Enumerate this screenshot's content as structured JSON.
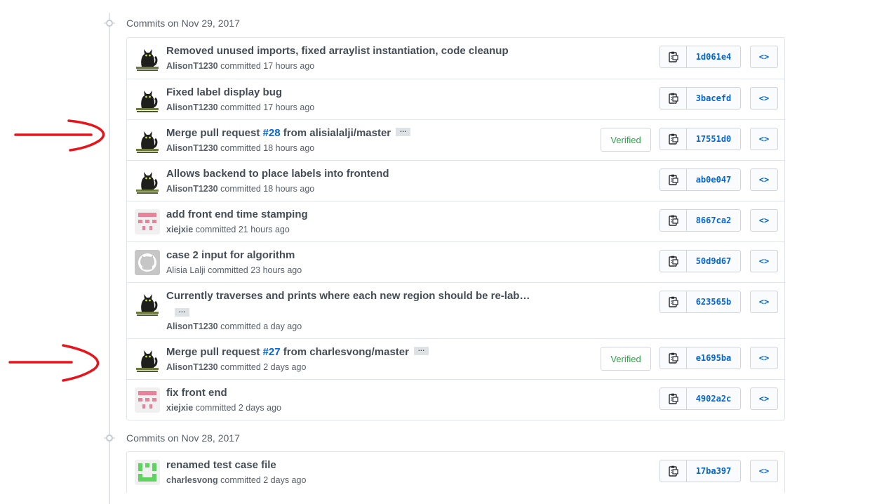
{
  "groups": [
    {
      "title": "Commits on Nov 29, 2017",
      "commits": [
        {
          "message": "Removed unused imports, fixed arraylist instantiation, code cleanup",
          "author": "AlisonT1230",
          "time": "committed 17 hours ago",
          "sha": "1d061e4",
          "avatar": "cat"
        },
        {
          "message": "Fixed label display bug",
          "author": "AlisonT1230",
          "time": "committed 17 hours ago",
          "sha": "3bacefd",
          "avatar": "cat"
        },
        {
          "message_pre": "Merge pull request ",
          "pr": "#28",
          "message_post": " from alisialalji/master",
          "author": "AlisonT1230",
          "time": "committed 18 hours ago",
          "sha": "17551d0",
          "verified": "Verified",
          "avatar": "cat"
        },
        {
          "message": "Allows backend to place labels into frontend",
          "author": "AlisonT1230",
          "time": "committed 18 hours ago",
          "sha": "ab0e047",
          "avatar": "cat"
        },
        {
          "message": "add front end time stamping",
          "author": "xiejxie",
          "time": "committed 21 hours ago",
          "sha": "8667ca2",
          "avatar": "pink-identicon"
        },
        {
          "message": "case 2 input for algorithm",
          "author": "Alisia Lalji",
          "time": "committed 23 hours ago",
          "sha": "50d9d67",
          "avatar": "default-octocat"
        },
        {
          "message": "Currently traverses and prints where each new region should be re-lab…",
          "author": "AlisonT1230",
          "time": "committed a day ago",
          "sha": "623565b",
          "avatar": "cat"
        },
        {
          "message_pre": "Merge pull request ",
          "pr": "#27",
          "message_post": " from charlesvong/master",
          "author": "AlisonT1230",
          "time": "committed 2 days ago",
          "sha": "e1695ba",
          "verified": "Verified",
          "avatar": "cat"
        },
        {
          "message": "fix front end",
          "author": "xiejxie",
          "time": "committed 2 days ago",
          "sha": "4902a2c",
          "avatar": "pink-identicon"
        }
      ]
    },
    {
      "title": "Commits on Nov 28, 2017",
      "commits": [
        {
          "message": "renamed test case file",
          "author": "charlesvong",
          "time": "committed 2 days ago",
          "sha": "17ba397",
          "avatar": "green-identicon"
        }
      ]
    }
  ],
  "icons": {
    "copy": "clipboard-icon",
    "browse": "<>",
    "ellipsis": "…"
  },
  "colors": {
    "link": "#0366d6",
    "verified": "#28a745",
    "annotation_arrow": "#e8141b"
  }
}
